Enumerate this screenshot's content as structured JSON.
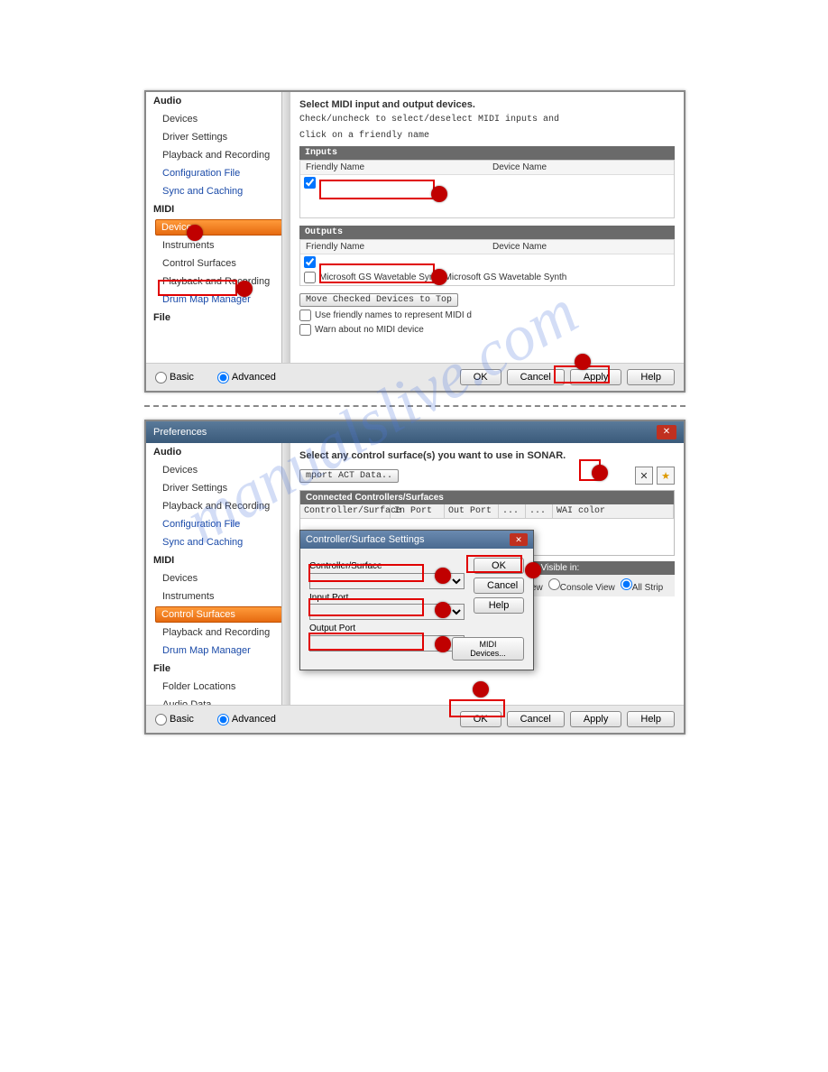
{
  "watermark": "manualslive.com",
  "screenshot1": {
    "sidebar": {
      "cat_audio": "Audio",
      "audio_items": [
        "Devices",
        "Driver Settings",
        "Playback and Recording",
        "Configuration File",
        "Sync and Caching"
      ],
      "cat_midi": "MIDI",
      "midi_items": [
        "Devices",
        "Instruments",
        "Control Surfaces",
        "Playback and Recording",
        "Drum Map Manager"
      ],
      "cat_file": "File",
      "selected": "Devices"
    },
    "main": {
      "heading": "Select MIDI input and output devices.",
      "hint1": "Check/uncheck to select/deselect MIDI inputs and",
      "hint2": "Click on a friendly name",
      "inputs_bar": "Inputs",
      "outputs_bar": "Outputs",
      "col_friendly": "Friendly Name",
      "col_device": "Device Name",
      "out_row": "Microsoft GS Wavetable Synth Microsoft GS Wavetable Synth",
      "move_btn": "Move Checked Devices to Top",
      "chk1": "Use friendly names to represent MIDI d",
      "chk2": "Warn about no MIDI device"
    },
    "footer": {
      "basic": "Basic",
      "advanced": "Advanced",
      "ok": "OK",
      "cancel": "Cancel",
      "apply": "Apply",
      "help": "Help"
    }
  },
  "screenshot2": {
    "title": "Preferences",
    "sidebar": {
      "cat_audio": "Audio",
      "audio_items": [
        "Devices",
        "Driver Settings",
        "Playback and Recording",
        "Configuration File",
        "Sync and Caching"
      ],
      "cat_midi": "MIDI",
      "midi_items": [
        "Devices",
        "Instruments",
        "Control Surfaces",
        "Playback and Recording",
        "Drum Map Manager"
      ],
      "cat_file": "File",
      "file_items": [
        "Folder Locations",
        "Audio Data"
      ],
      "selected": "Control Surfaces"
    },
    "main": {
      "heading": "Select any control surface(s) you want to use in SONAR.",
      "import_btn": "mport ACT Data..",
      "table_title": "Connected Controllers/Surfaces",
      "cols": [
        "Controller/Surface",
        "In Port",
        "Out Port",
        "...",
        "...",
        "WAI color"
      ],
      "strip_label": "trips Visible in:",
      "strip_opts": [
        "ew",
        "Console View",
        "All Strip"
      ]
    },
    "modal": {
      "title": "Controller/Surface Settings",
      "lbl_ctrl": "Controller/Surface",
      "lbl_in": "Input Port",
      "lbl_out": "Output Port",
      "ok": "OK",
      "cancel": "Cancel",
      "help": "Help",
      "midi": "MIDI Devices..."
    },
    "footer": {
      "basic": "Basic",
      "advanced": "Advanced",
      "ok": "OK",
      "cancel": "Cancel",
      "apply": "Apply",
      "help": "Help"
    }
  }
}
